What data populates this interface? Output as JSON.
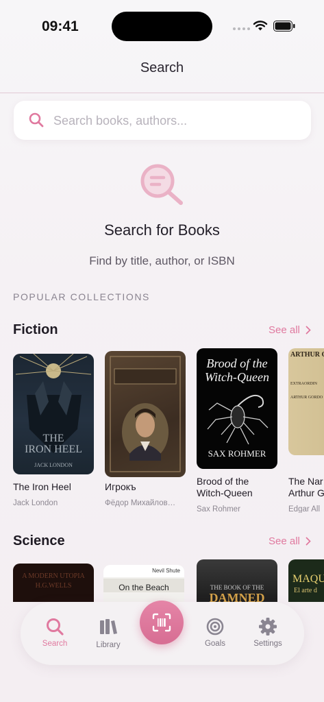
{
  "status": {
    "time": "09:41"
  },
  "nav": {
    "title": "Search"
  },
  "search": {
    "placeholder": "Search books, authors..."
  },
  "empty_state": {
    "icon": "search-doc-icon",
    "title": "Search for Books",
    "subtitle": "Find by title, author, or ISBN"
  },
  "popular": {
    "header": "POPULAR COLLECTIONS",
    "collections": [
      {
        "title": "Fiction",
        "see_all": "See all",
        "books": [
          {
            "title_line1": "The Iron Heel",
            "title_line2": "",
            "author": "Jack London",
            "cover_line1": "THE",
            "cover_line2": "IRON HEEL",
            "cover_author": "JACK LONDON"
          },
          {
            "title_line1": "Игрокъ",
            "title_line2": "",
            "author": "Фёдор Михайлов…",
            "cover_line1": "",
            "cover_line2": "",
            "cover_author": ""
          },
          {
            "title_line1": "Brood of the",
            "title_line2": "Witch-Queen",
            "author": "Sax Rohmer",
            "cover_line1": "Brood of the",
            "cover_line2": "Witch-Queen",
            "cover_author": "SAX ROHMER"
          },
          {
            "title_line1": "The Nar",
            "title_line2": "Arthur G",
            "author": "Edgar All",
            "cover_line1": "ARTHUR G",
            "cover_line2": "EXTRAORDIN",
            "cover_author": "ARTHUR GORDO"
          }
        ]
      },
      {
        "title": "Science",
        "see_all": "See all",
        "books": [
          {
            "cover_line1": "A MODERN UTOPIA",
            "cover_line2": "H.G.WELLS"
          },
          {
            "cover_line1": "Nevil Shute",
            "cover_line2": "On the Beach"
          },
          {
            "cover_line1": "THE BOOK OF THE",
            "cover_line2": "DAMNED"
          },
          {
            "cover_line1": "MAQU",
            "cover_line2": "El arte d"
          }
        ]
      }
    ]
  },
  "tabs": [
    {
      "label": "Search",
      "icon": "magnifier-icon",
      "active": true
    },
    {
      "label": "Library",
      "icon": "books-icon",
      "active": false
    },
    {
      "label": "Scan",
      "icon": "barcode-scan-icon",
      "active": false
    },
    {
      "label": "Goals",
      "icon": "target-icon",
      "active": false
    },
    {
      "label": "Settings",
      "icon": "gear-icon",
      "active": false
    }
  ],
  "colors": {
    "accent": "#e0799f",
    "accent_dark": "#d76d93",
    "background": "#f6f2f5"
  }
}
